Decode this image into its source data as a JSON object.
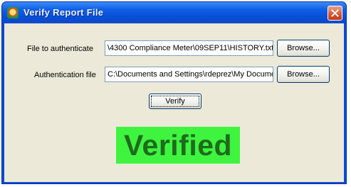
{
  "window": {
    "title": "Verify Report File",
    "app_icon": "app-icon",
    "close_icon": "close-icon"
  },
  "form": {
    "file_label": "File to authenticate",
    "file_value": "\\4300 Compliance Meter\\09SEP11\\HISTORY.txt",
    "auth_label": "Authentication file",
    "auth_value": "C:\\Documents and Settings\\rdeprez\\My Docume",
    "browse_label": "Browse...",
    "verify_label": "Verify"
  },
  "status": {
    "text": "Verified",
    "background_color": "#3ff43f",
    "text_color": "#1e6b1e"
  }
}
